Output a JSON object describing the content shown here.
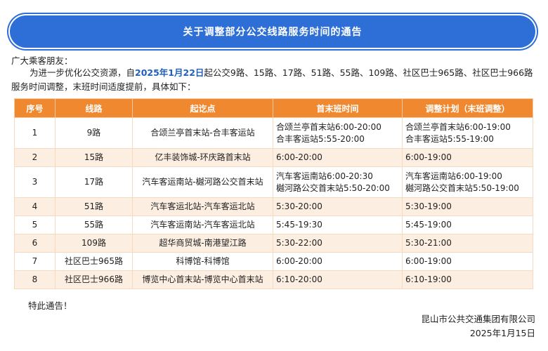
{
  "title": "关于调整部分公交线路服务时间的通告",
  "greeting": "广大乘客朋友：",
  "intro": {
    "before": "为进一步优化公交资源，自",
    "date": "2025年1月22日",
    "after": "起公交9路、15路、17路、51路、55路、109路、社区巴士965路、社区巴士966路服务时间调整，末班时间适度提前，具体如下："
  },
  "table": {
    "headers": [
      "序号",
      "线路",
      "起讫点",
      "首末班时间",
      "调整计划（末班调整）"
    ],
    "rows": [
      {
        "no": "1",
        "route": "9路",
        "stops": "合颂兰亭首末站-合丰客运站",
        "times": [
          "合颂兰亭首末站6:00-20:00",
          "合丰客运站5:55-20:00"
        ],
        "plan": [
          "合颂兰亭首末站6:00-19:00",
          "合丰客运站5:55-19:00"
        ]
      },
      {
        "no": "2",
        "route": "15路",
        "stops": "亿丰装饰城-环庆路首末站",
        "times": [
          "6:00-20:00"
        ],
        "plan": [
          "6:00-19:00"
        ]
      },
      {
        "no": "3",
        "route": "17路",
        "stops": "汽车客运南站-樾河路公交首末站",
        "times": [
          "汽车客运南站6:00-20:30",
          "樾河路公交首末站5:50-20:00"
        ],
        "plan": [
          "汽车客运南站6:00-19:00",
          "樾河路公交首末站5:50-19:00"
        ]
      },
      {
        "no": "4",
        "route": "51路",
        "stops": "汽车客运北站-汽车客运北站",
        "times": [
          "5:30-20:00"
        ],
        "plan": [
          "5:30-19:00"
        ]
      },
      {
        "no": "5",
        "route": "55路",
        "stops": "汽车客运南站-汽车客运北站",
        "times": [
          "5:45-19:30"
        ],
        "plan": [
          "5:45-19:00"
        ]
      },
      {
        "no": "6",
        "route": "109路",
        "stops": "超华商贸城-南港望江路",
        "times": [
          "5:30-22:00"
        ],
        "plan": [
          "5:30-21:00"
        ]
      },
      {
        "no": "7",
        "route": "社区巴士965路",
        "stops": "科博馆-科博馆",
        "times": [
          "6:00-20:00"
        ],
        "plan": [
          "6:00-19:00"
        ]
      },
      {
        "no": "8",
        "route": "社区巴士966路",
        "stops": "博览中心首末站-博览中心首末站",
        "times": [
          "6:10-20:00"
        ],
        "plan": [
          "6:10-19:00"
        ]
      }
    ]
  },
  "closing": "特此通告！",
  "company": "昆山市公共交通集团有限公司",
  "date": "2025年1月15日",
  "colors": {
    "banner": "#2d6fd6",
    "header": "#f0882f",
    "row_alt": "#fdeee2",
    "highlight": "#1f5fbf"
  }
}
